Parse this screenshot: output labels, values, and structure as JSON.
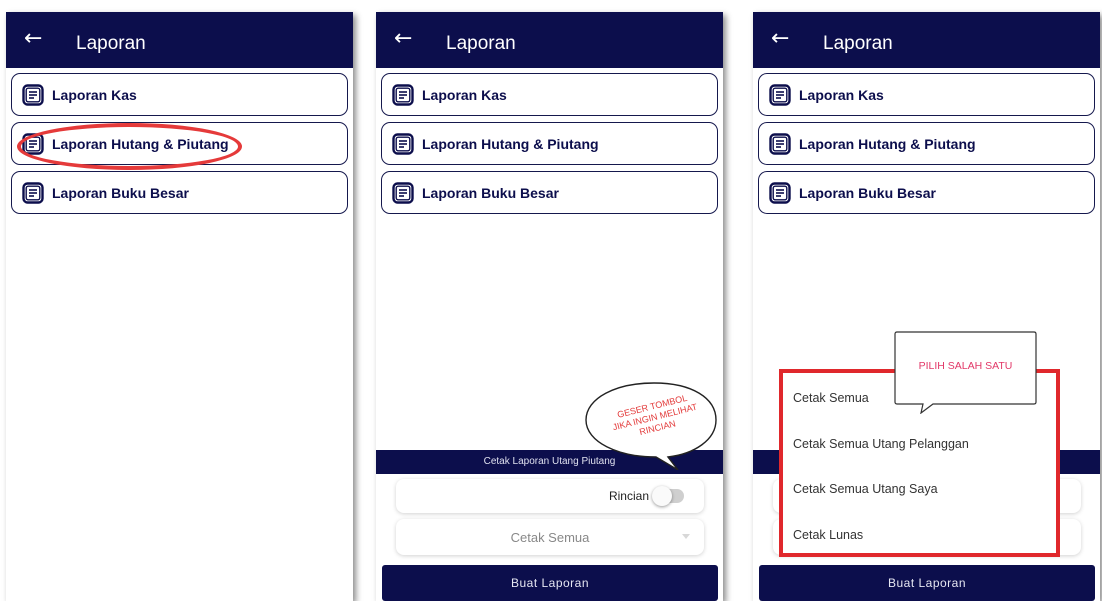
{
  "appbar": {
    "title": "Laporan",
    "back_icon": "arrow-left-icon"
  },
  "menu_items": [
    {
      "label": "Laporan Kas",
      "icon": "report-icon"
    },
    {
      "label": "Laporan Hutang & Piutang",
      "icon": "report-icon"
    },
    {
      "label": "Laporan Buku Besar",
      "icon": "report-icon"
    }
  ],
  "print_sheet": {
    "title": "Cetak Laporan Utang Piutang",
    "rincian_label": "Rincian",
    "rincian_enabled": false,
    "selected_option": "Cetak Semua",
    "submit_label": "Buat Laporan"
  },
  "print_options": [
    "Cetak Semua",
    "Cetak Semua Utang Pelanggan",
    "Cetak Semua Utang Saya",
    "Cetak Lunas"
  ],
  "annotations": {
    "toggle_hint": [
      "GESER TOMBOL",
      "JIKA INGIN MELIHAT",
      "RINCIAN"
    ],
    "select_hint": "PILIH SALAH SATU",
    "highlight_color": "#e0282c"
  },
  "colors": {
    "primary": "#0c0e4c",
    "accent_red": "#e53a3a"
  }
}
